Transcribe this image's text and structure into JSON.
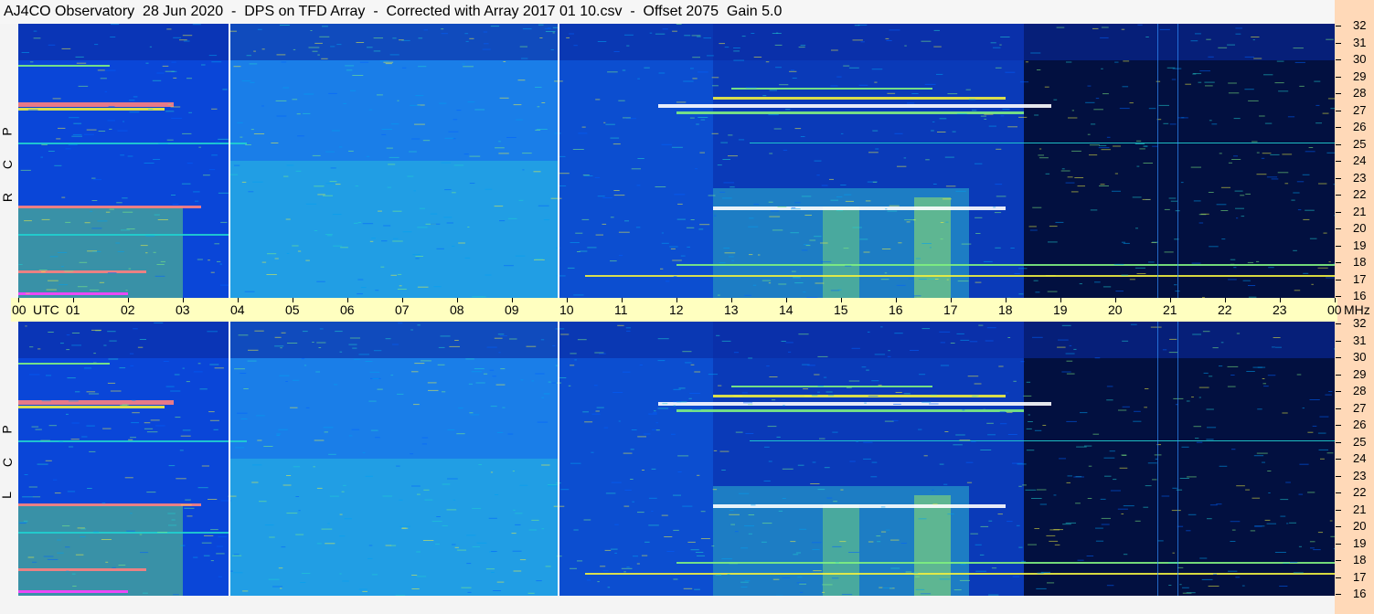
{
  "title": "AJ4CO Observatory  28 Jun 2020  -  DPS on TFD Array  -  Corrected with Array 2017 01 10.csv  -  Offset 2075  Gain 5.0",
  "chart_data": {
    "type": "heatmap",
    "title": "AJ4CO Observatory  28 Jun 2020  -  DPS on TFD Array  -  Corrected with Array 2017 01 10.csv  -  Offset 2075  Gain 5.0",
    "x_axis": {
      "unit_label": "UTC",
      "tick_labels": [
        "00",
        "01",
        "02",
        "03",
        "04",
        "05",
        "06",
        "07",
        "08",
        "09",
        "10",
        "11",
        "12",
        "13",
        "14",
        "15",
        "16",
        "17",
        "18",
        "19",
        "20",
        "21",
        "22",
        "23",
        "00"
      ],
      "range_hours": [
        0,
        24
      ]
    },
    "y_axis": {
      "unit_label": "MHz",
      "tick_labels": [
        "32",
        "31",
        "30",
        "29",
        "28",
        "27",
        "26",
        "25",
        "24",
        "23",
        "22",
        "21",
        "20",
        "19",
        "18",
        "17",
        "16"
      ],
      "range_mhz": [
        16,
        32
      ]
    },
    "panels": [
      {
        "polarization_letters": [
          "R",
          "C",
          "P"
        ]
      },
      {
        "polarization_letters": [
          "L",
          "C",
          "P"
        ]
      }
    ],
    "colormap": [
      "#000010",
      "#001060",
      "#0030c0",
      "#0060ff",
      "#00a0f0",
      "#20d0d0",
      "#80f080",
      "#f0f040",
      "#ff8080",
      "#ff40ff",
      "#ffffff"
    ]
  }
}
